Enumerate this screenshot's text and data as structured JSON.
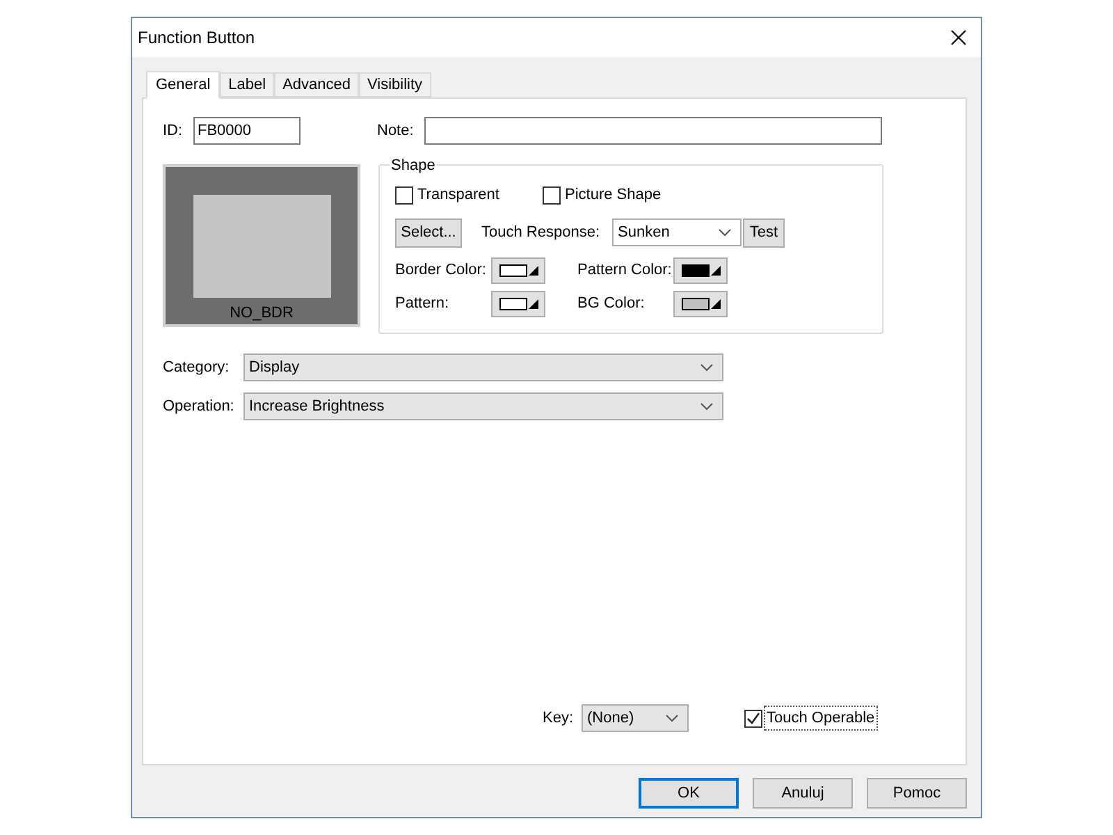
{
  "window": {
    "title": "Function Button"
  },
  "tabs": [
    {
      "label": "General",
      "selected": true
    },
    {
      "label": "Label",
      "selected": false
    },
    {
      "label": "Advanced",
      "selected": false
    },
    {
      "label": "Visibility",
      "selected": false
    }
  ],
  "id_field": {
    "label": "ID:",
    "value": "FB0000"
  },
  "note_field": {
    "label": "Note:"
  },
  "preview": {
    "caption": "NO_BDR"
  },
  "shape": {
    "title": "Shape",
    "checkboxes": [
      {
        "label": "Transparent",
        "checked": false
      },
      {
        "label": "Picture Shape",
        "checked": false
      }
    ],
    "select_button": "Select...",
    "touch_response": {
      "label": "Touch Response:",
      "value": "Sunken"
    },
    "test_button": "Test",
    "swatches": [
      {
        "label": "Border Color:",
        "color": "#ffffff"
      },
      {
        "label": "Pattern Color:",
        "color": "#000000"
      },
      {
        "label": "Pattern:",
        "color": "#ffffff"
      },
      {
        "label": "BG Color:",
        "color": "#c0c0c0"
      }
    ]
  },
  "category": {
    "label": "Category:",
    "value": "Display"
  },
  "operation": {
    "label": "Operation:",
    "value": "Increase Brightness"
  },
  "key": {
    "label": "Key:",
    "value": "(None)"
  },
  "touch_operable": {
    "label": "Touch Operable",
    "checked": true
  },
  "buttons": [
    {
      "label": "OK",
      "default": true
    },
    {
      "label": "Anuluj",
      "default": false
    },
    {
      "label": "Pomoc",
      "default": false
    }
  ]
}
